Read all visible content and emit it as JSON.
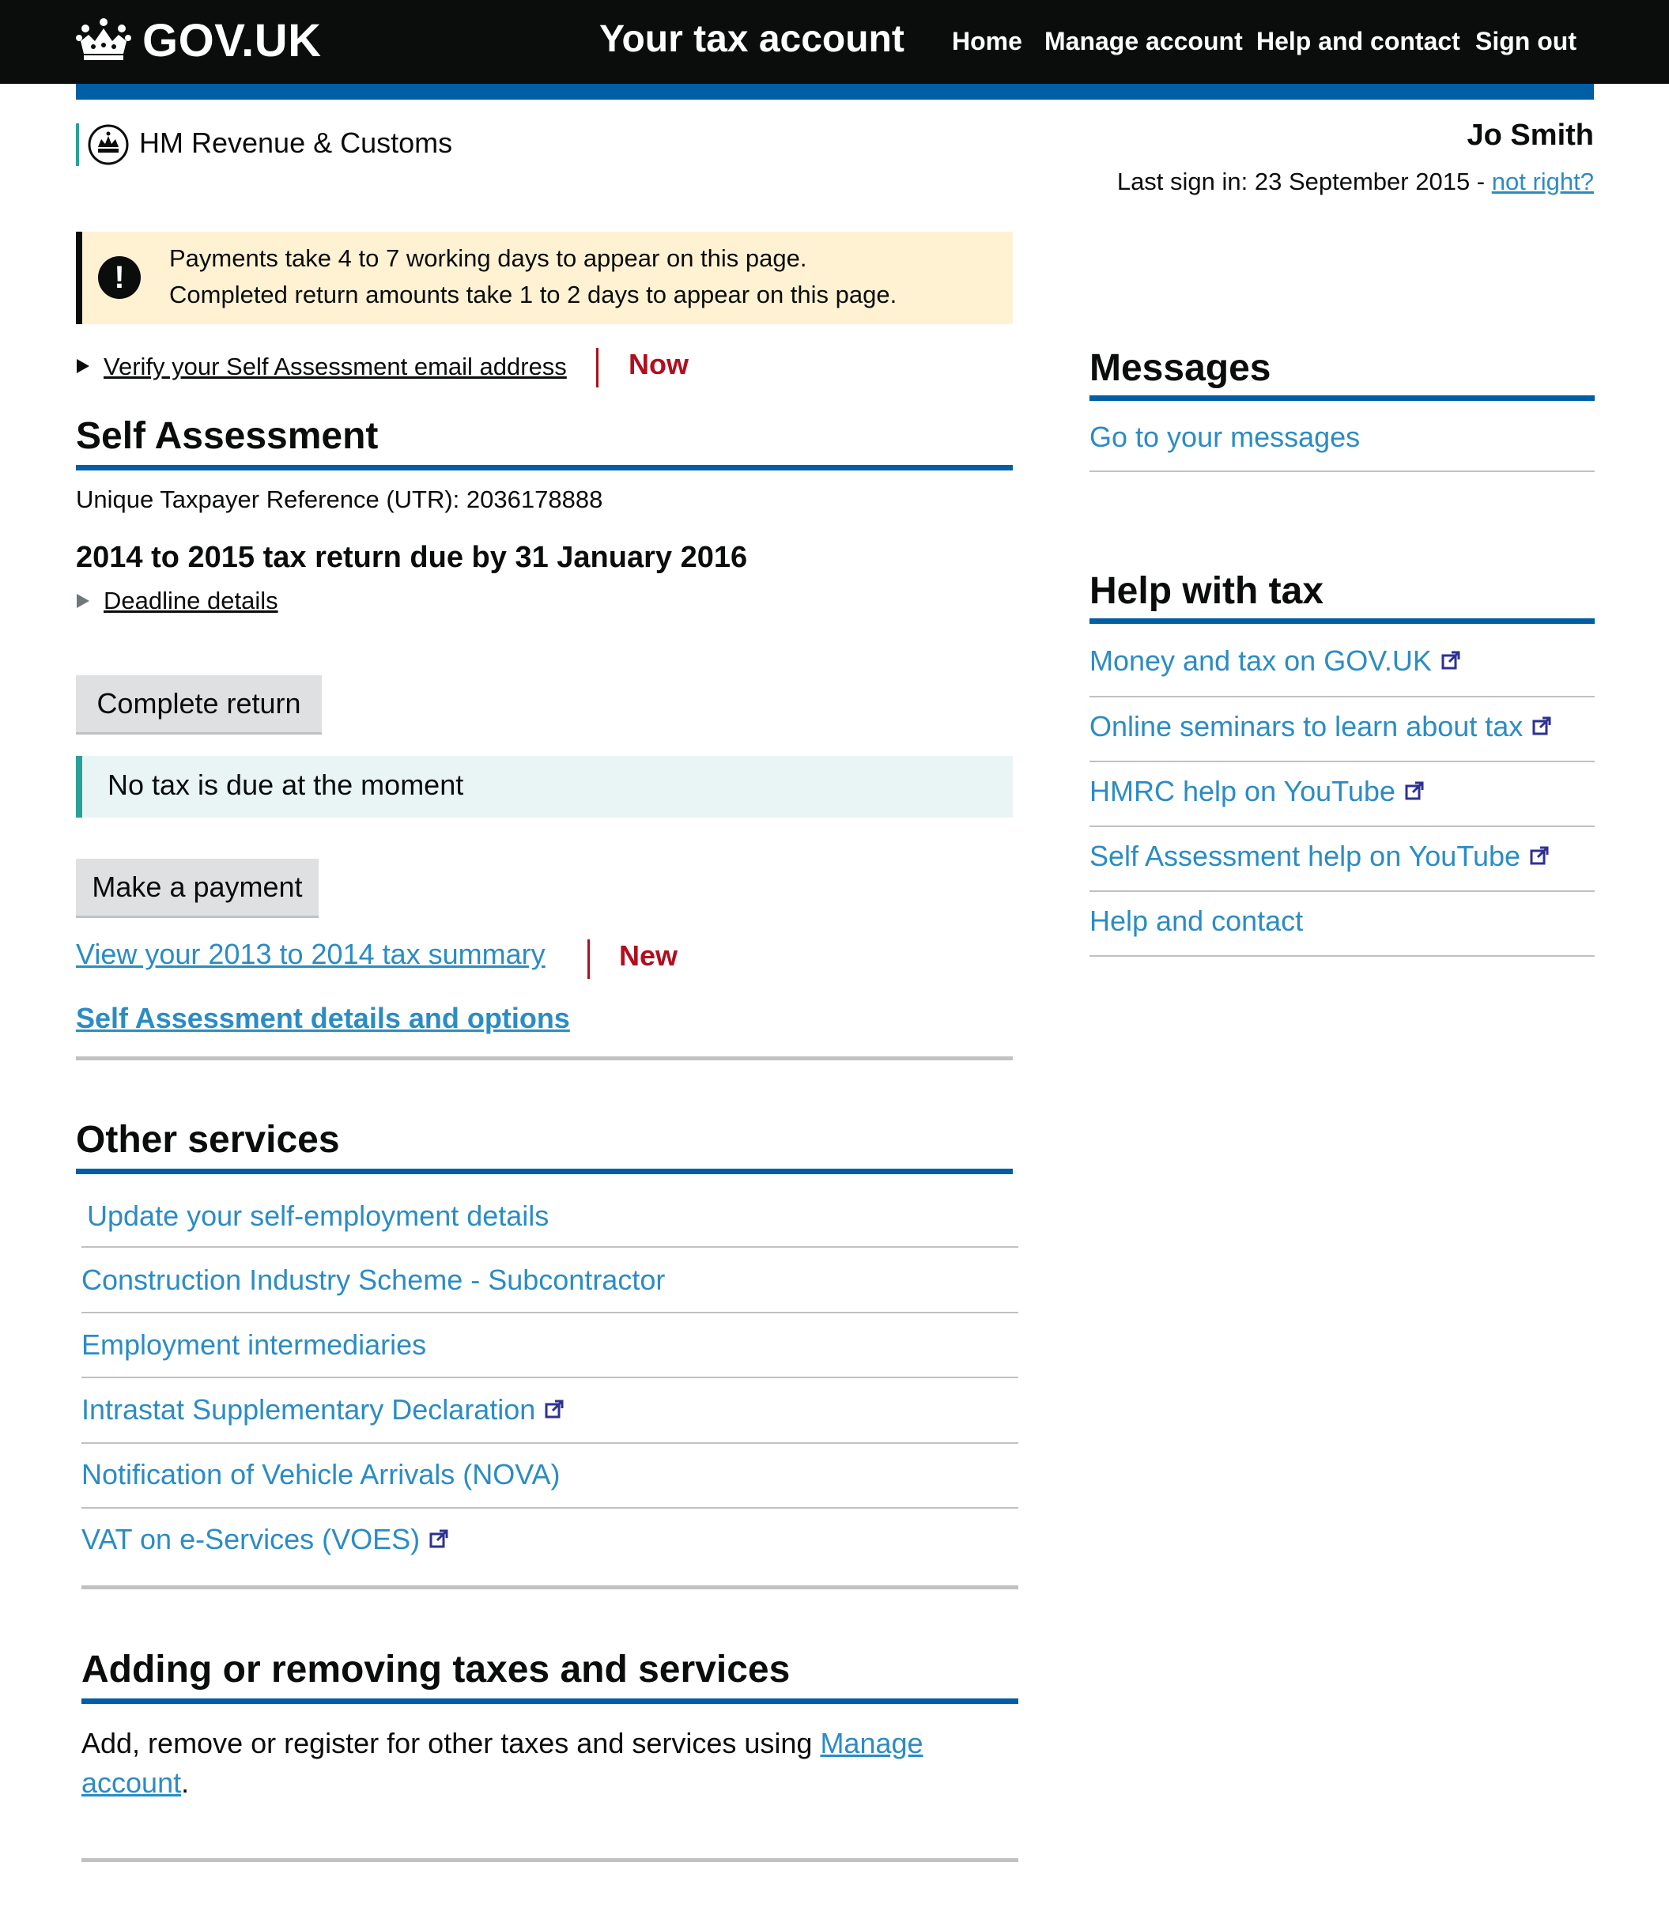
{
  "header": {
    "logo": "GOV.UK",
    "service_name": "Your tax account",
    "nav": [
      "Home",
      "Manage account",
      "Help and contact",
      "Sign out"
    ]
  },
  "org": {
    "name": "HM Revenue & Customs"
  },
  "user": {
    "name": "Jo Smith",
    "last_sign_in": "Last sign in: 23 September 2015 - ",
    "not_right": "not right?"
  },
  "notice": {
    "line1": "Payments take 4 to 7 working days to appear on this page.",
    "line2": "Completed return amounts take 1 to 2 days to appear on this page."
  },
  "verify": {
    "label": "Verify your Self Assessment email address",
    "tag": "Now"
  },
  "self_assessment": {
    "heading": "Self Assessment",
    "utr": "Unique Taxpayer Reference (UTR): 2036178888",
    "return_due": "2014 to 2015 tax return due by 31 January 2016",
    "deadline_details": "Deadline details",
    "complete_return": "Complete return",
    "no_tax_due": "No tax is due at the moment",
    "make_payment": "Make a payment",
    "tax_summary_link": "View your 2013 to 2014 tax summary",
    "tax_summary_tag": "New",
    "details_link": "Self Assessment details and options"
  },
  "other_services": {
    "heading": "Other services",
    "items": [
      {
        "label": "Update your self-employment details",
        "external": false
      },
      {
        "label": "Construction Industry Scheme - Subcontractor",
        "external": false
      },
      {
        "label": "Employment intermediaries",
        "external": false
      },
      {
        "label": "Intrastat Supplementary Declaration",
        "external": true
      },
      {
        "label": "Notification of Vehicle Arrivals (NOVA)",
        "external": false
      },
      {
        "label": "VAT on e-Services (VOES)",
        "external": true
      }
    ]
  },
  "adding": {
    "heading": "Adding or removing taxes and services",
    "text": "Add, remove or register for other taxes and services using ",
    "link1": "Manage",
    "link2": "account",
    "end": "."
  },
  "messages": {
    "heading": "Messages",
    "link": "Go to your messages"
  },
  "help": {
    "heading": "Help with tax",
    "items": [
      {
        "label": "Money and tax on GOV.UK",
        "external": true
      },
      {
        "label": "Online seminars to learn about tax",
        "external": true
      },
      {
        "label": "HMRC help on YouTube",
        "external": true
      },
      {
        "label": "Self Assessment help on YouTube",
        "external": true
      },
      {
        "label": "Help and contact",
        "external": false
      }
    ]
  },
  "colors": {
    "header_bg": "#0b0c0c",
    "brand_blue": "#005ea5",
    "link": "#2b8cc4",
    "notice_bg": "#fff2d3",
    "inset_bg": "#e8f5f4",
    "hmrc_green": "#28a197",
    "tag_red": "#b10e1e"
  },
  "icons": [
    "crown-icon",
    "hmrc-crest-icon",
    "warning-icon",
    "external-link-icon"
  ]
}
